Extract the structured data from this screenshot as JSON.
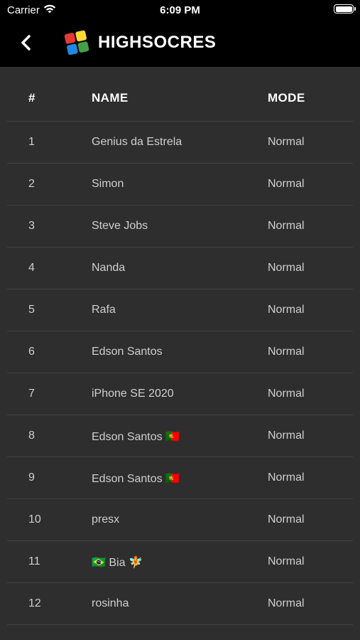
{
  "status_bar": {
    "carrier": "Carrier",
    "time": "6:09 PM"
  },
  "nav": {
    "title": "HIGHSOCRES",
    "logo_colors": [
      "#e53935",
      "#fdd835",
      "#43a047",
      "#1e88e5"
    ]
  },
  "table": {
    "headers": {
      "rank": "#",
      "name": "NAME",
      "mode": "MODE"
    },
    "rows": [
      {
        "rank": "1",
        "name": "Genius da Estrela",
        "mode": "Normal"
      },
      {
        "rank": "2",
        "name": "Simon",
        "mode": "Normal"
      },
      {
        "rank": "3",
        "name": "Steve Jobs",
        "mode": "Normal"
      },
      {
        "rank": "4",
        "name": "Nanda",
        "mode": "Normal"
      },
      {
        "rank": "5",
        "name": "Rafa",
        "mode": "Normal"
      },
      {
        "rank": "6",
        "name": "Edson Santos",
        "mode": "Normal"
      },
      {
        "rank": "7",
        "name": "iPhone SE 2020",
        "mode": "Normal"
      },
      {
        "rank": "8",
        "name": "Edson Santos 🇵🇹",
        "mode": "Normal"
      },
      {
        "rank": "9",
        "name": "Edson Santos 🇵🇹",
        "mode": "Normal"
      },
      {
        "rank": "10",
        "name": "presx",
        "mode": "Normal"
      },
      {
        "rank": "11",
        "name": "🇧🇷 Bia 🧚",
        "mode": "Normal"
      },
      {
        "rank": "12",
        "name": "rosinha",
        "mode": "Normal"
      }
    ]
  }
}
